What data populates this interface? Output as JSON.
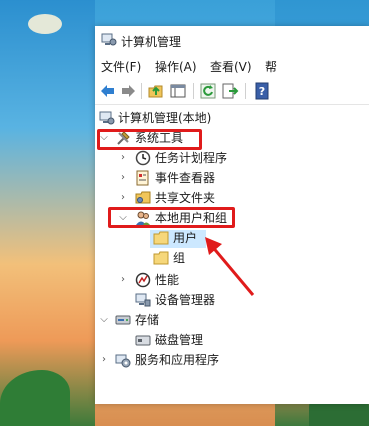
{
  "window": {
    "title": "计算机管理"
  },
  "menu": [
    {
      "label": "文件(F)"
    },
    {
      "label": "操作(A)"
    },
    {
      "label": "查看(V)"
    },
    {
      "label": "帮"
    }
  ],
  "toolbar": [
    "back-arrow-icon",
    "forward-arrow-icon",
    "up-folder-icon",
    "show-hide-tree-icon",
    "refresh-icon",
    "export-list-icon",
    "help-icon"
  ],
  "tree": {
    "root": "计算机管理(本地)",
    "system_tools": "系统工具",
    "task_scheduler": "任务计划程序",
    "event_viewer": "事件查看器",
    "shared_folders": "共享文件夹",
    "local_users_groups": "本地用户和组",
    "users": "用户",
    "groups": "组",
    "performance": "性能",
    "device_manager": "设备管理器",
    "storage": "存储",
    "disk_management": "磁盘管理",
    "services_apps": "服务和应用程序"
  },
  "colors": {
    "highlight": "#e01b1b",
    "selection": "#cce8ff"
  }
}
